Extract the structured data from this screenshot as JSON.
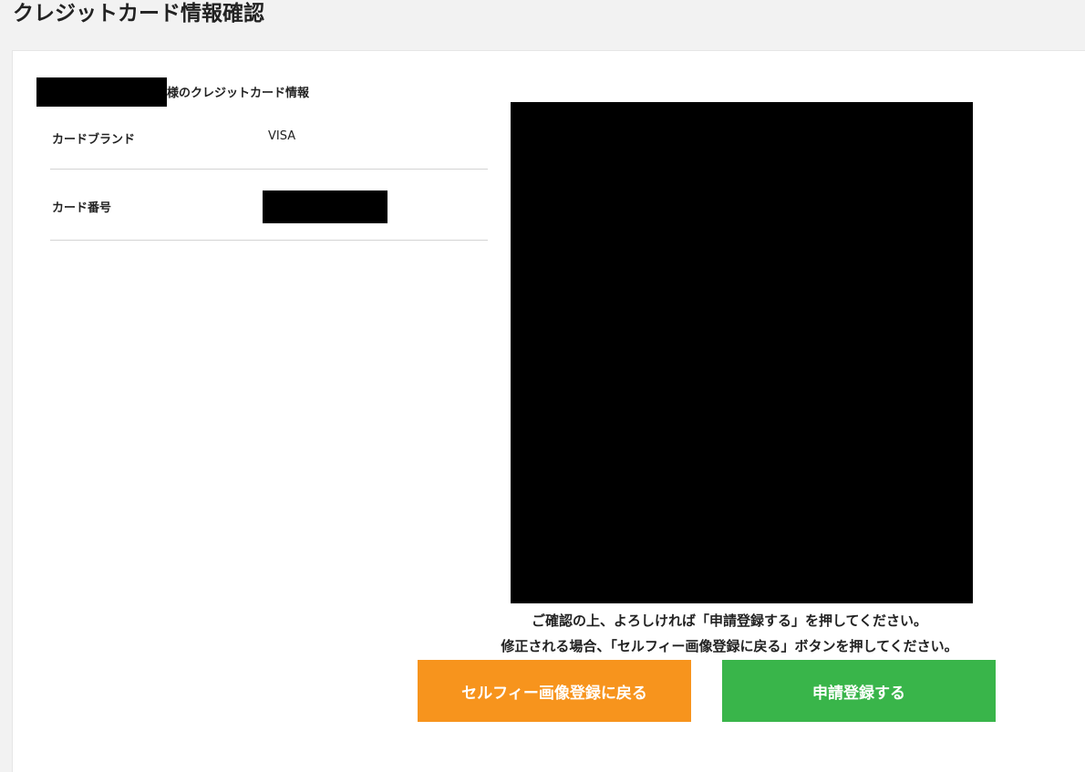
{
  "header": {
    "title": "クレジットカード情報確認"
  },
  "owner": {
    "suffix": "様のクレジットカード情報"
  },
  "card_info": {
    "rows": [
      {
        "label": "カードブランド",
        "value": "VISA"
      },
      {
        "label": "カード番号",
        "value": ""
      }
    ]
  },
  "notice": {
    "line1": "ご確認の上、よろしければ「申請登録する」を押してください。",
    "line2": "修正される場合、「セルフィー画像登録に戻る」ボタンを押してください。"
  },
  "buttons": {
    "back_label": "セルフィー画像登録に戻る",
    "submit_label": "申請登録する"
  },
  "colors": {
    "back_button": "#f7941d",
    "submit_button": "#39b54a"
  }
}
